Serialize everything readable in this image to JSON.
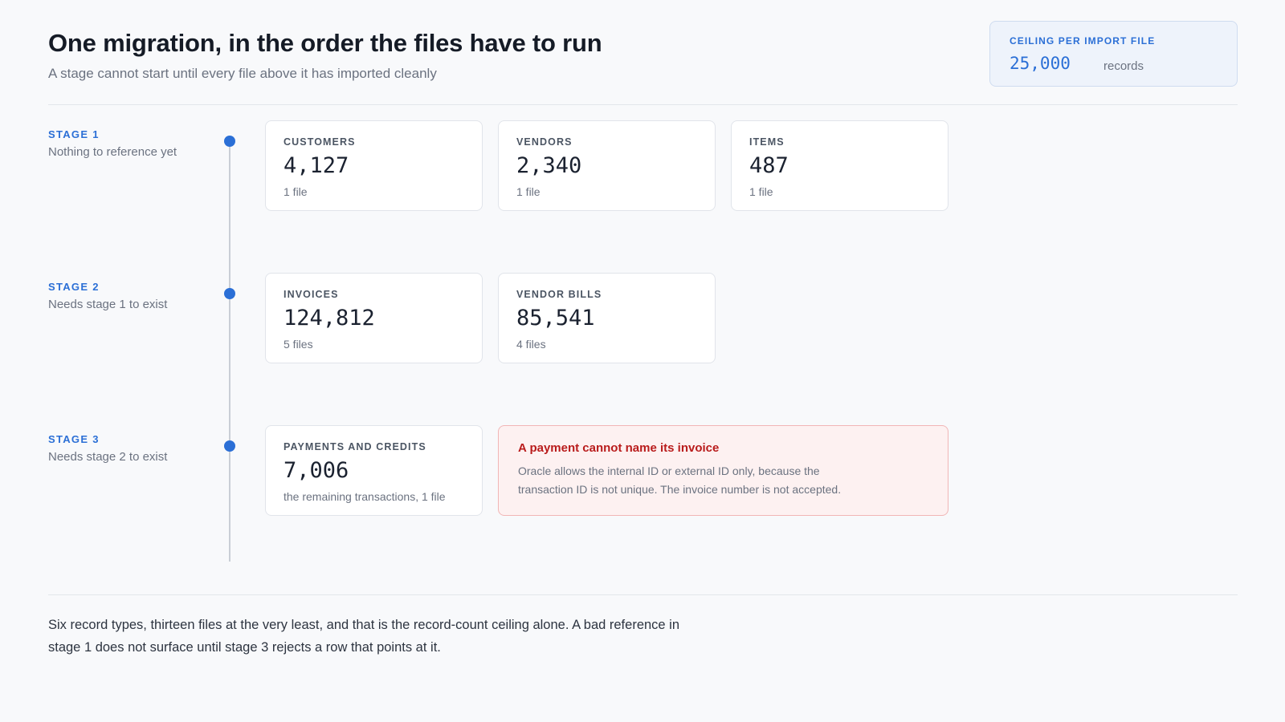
{
  "header": {
    "title": "One migration, in the order the files have to run",
    "subtitle": "A stage cannot start until every file above it has imported cleanly"
  },
  "ceiling": {
    "label": "CEILING PER IMPORT FILE",
    "value": "25,000",
    "unit": "records"
  },
  "stages": [
    {
      "label": "STAGE 1",
      "description": "Nothing to reference yet",
      "cards": [
        {
          "name": "CUSTOMERS",
          "value": "4,127",
          "files": "1 file"
        },
        {
          "name": "VENDORS",
          "value": "2,340",
          "files": "1 file"
        },
        {
          "name": "ITEMS",
          "value": "487",
          "files": "1 file"
        }
      ]
    },
    {
      "label": "STAGE 2",
      "description": "Needs stage 1 to exist",
      "cards": [
        {
          "name": "INVOICES",
          "value": "124,812",
          "files": "5 files"
        },
        {
          "name": "VENDOR BILLS",
          "value": "85,541",
          "files": "4 files"
        }
      ]
    },
    {
      "label": "STAGE 3",
      "description": "Needs stage 2 to exist",
      "cards": [
        {
          "name": "PAYMENTS AND CREDITS",
          "value": "7,006",
          "files": "the remaining transactions, 1 file"
        }
      ],
      "warning": {
        "title": "A payment cannot name its invoice",
        "body": "Oracle allows the internal ID or external ID only, because the transaction ID is not unique. The invoice number is not accepted."
      }
    }
  ],
  "footer": {
    "text": "Six record types, thirteen files at the very least, and that is the record-count ceiling alone. A bad reference in stage 1 does not surface until stage 3 rejects a row that points at it."
  },
  "colors": {
    "accent": "#2b6fd6",
    "warning": "#b91c1c",
    "warning_bg": "#fdf1f1"
  }
}
